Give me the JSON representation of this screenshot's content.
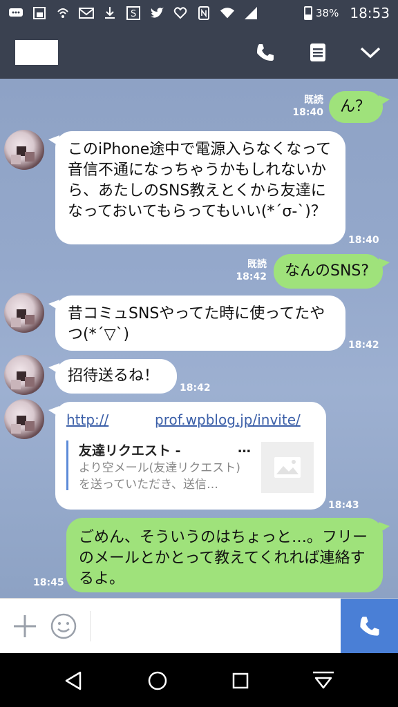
{
  "status_bar": {
    "battery_percent": "38%",
    "battery_level": 0.38,
    "time": "18:53",
    "icons": [
      "chat-icon",
      "screenshot-icon",
      "wifi-calling-icon",
      "mail-icon",
      "download-icon",
      "s-app-icon",
      "twitter-icon",
      "heart-app-icon",
      "nfc-icon",
      "wifi-icon",
      "signal-icon",
      "battery-icon"
    ]
  },
  "header": {
    "actions": [
      "phone-icon",
      "menu-icon",
      "chevron-down-icon"
    ]
  },
  "messages": [
    {
      "id": "m1",
      "side": "out",
      "text": "ん？",
      "read": "既読",
      "time": "18:40"
    },
    {
      "id": "m2",
      "side": "in",
      "text": "このiPhone途中で電源入らなくなって音信不通になっちゃうかもしれないから、あたしのSNS教えとくから友達になっておいてもらってもいい(*´σ-`)？",
      "time": "18:40"
    },
    {
      "id": "m3",
      "side": "out",
      "text": "なんのSNS?",
      "read": "既読",
      "time": "18:42"
    },
    {
      "id": "m4",
      "side": "in",
      "text": "昔コミュSNSやってた時に使ってたやつ(*´▽`)",
      "time": "18:42"
    },
    {
      "id": "m5",
      "side": "in",
      "text": "招待送るね！",
      "time": "18:42"
    },
    {
      "id": "m6",
      "side": "in",
      "link_a": "http://",
      "link_b": "prof.wpblog.jp/invite/",
      "preview_title": "友達リクエスト -",
      "preview_dots": "…",
      "preview_desc": "より空メール(友達リクエスト)を送っていただき、送信…",
      "time": "18:43"
    },
    {
      "id": "m7",
      "side": "out",
      "text": "ごめん、そういうのはちょっと…。フリーのメールとかとって教えてくれれば連絡するよ。",
      "time": "18:45"
    }
  ],
  "input": {
    "icons": [
      "plus-icon",
      "emoji-icon",
      "call-icon"
    ]
  },
  "nav": {
    "icons": [
      "back-icon",
      "home-icon",
      "recents-icon",
      "notification-pull-icon"
    ]
  },
  "colors": {
    "header_bg": "#3a4150",
    "out_bubble": "#9fe27b",
    "in_bubble": "#ffffff",
    "call_button": "#4a7fd6",
    "link": "#3b5fa8"
  }
}
